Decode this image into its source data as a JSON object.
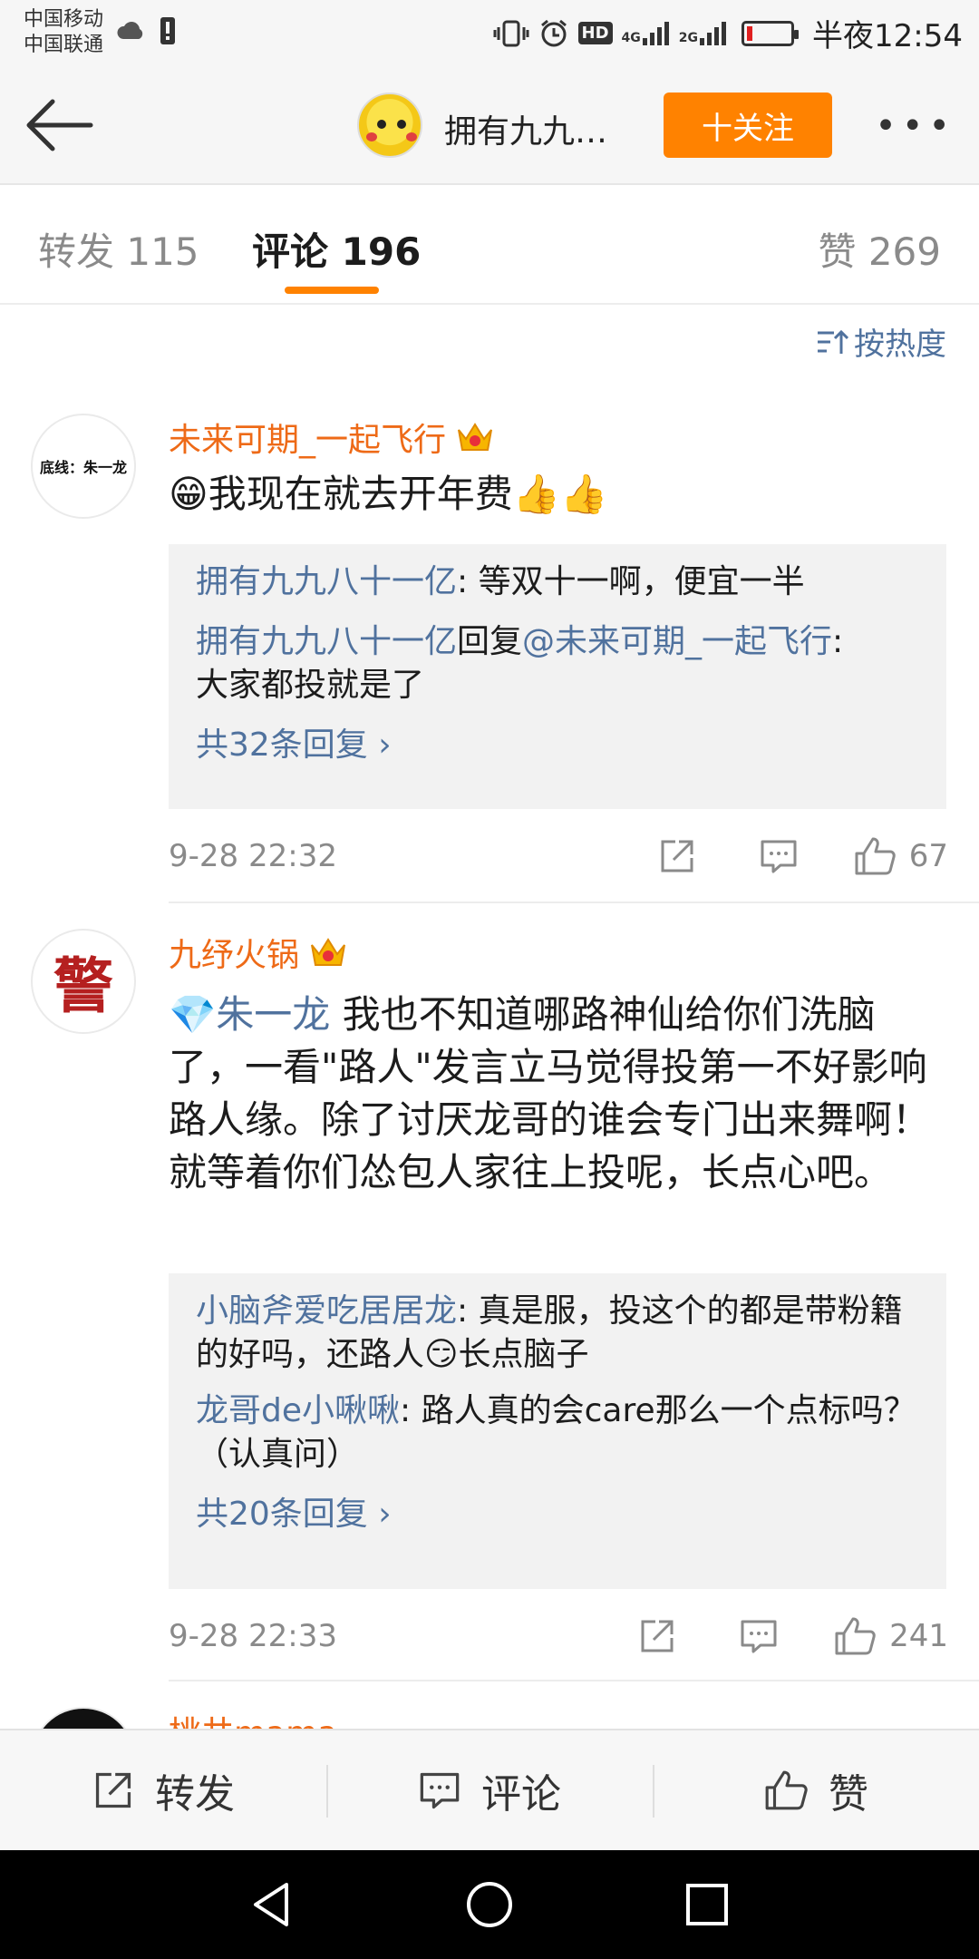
{
  "status_bar": {
    "carrier_1": "中国移动",
    "carrier_2": "中国联通",
    "network_1": "4G",
    "network_2": "2G",
    "hd_label": "HD",
    "time": "半夜12:54"
  },
  "navbar": {
    "title": "拥有九九…",
    "follow_label": "十关注",
    "more_label": "•••"
  },
  "tabs": {
    "repost": "转发 115",
    "comment": "评论 196",
    "like": "赞 269"
  },
  "sort_label": "按热度",
  "comments": [
    {
      "avatar_text": "底线：朱一龙",
      "username": "未来可期_一起飞行",
      "text": "😁我现在就去开年费👍👍",
      "replies": [
        {
          "user": "拥有九九八十一亿",
          "sep": ": ",
          "text": "等双十一啊，便宜一半"
        },
        {
          "user": "拥有九九八十一亿",
          "middle": "回复",
          "mention": "@未来可期_一起飞行",
          "sep": ":",
          "text": "大家都投就是了"
        }
      ],
      "more_replies": "共32条回复 ›",
      "time": "9-28 22:32",
      "likes": "67"
    },
    {
      "avatar_text": "警",
      "username": "九纾火锅",
      "mention": "💎朱一龙",
      "text": " 我也不知道哪路神仙给你们洗脑了，一看\"路人\"发言立马觉得投第一不好影响路人缘。除了讨厌龙哥的谁会专门出来舞啊！就等着你们怂包人家往上投呢，长点心吧。",
      "replies": [
        {
          "user": "小脑斧爱吃居居龙",
          "sep": ": ",
          "text": "真是服，投这个的都是带粉籍的好吗，还路人😏长点脑子"
        },
        {
          "user": "龙哥de小啾啾",
          "sep": ": ",
          "text": "路人真的会care那么一个点标吗？（认真问）"
        }
      ],
      "more_replies": "共20条回复 ›",
      "time": "9-28 22:33",
      "likes": "241"
    },
    {
      "username": "桃井mama"
    }
  ],
  "bottom_toolbar": {
    "repost": "转发",
    "comment": "评论",
    "like": "赞"
  },
  "colors": {
    "accent_orange": "#ff8200",
    "username_orange": "#ee6a17",
    "link_blue": "#50729e",
    "muted_gray": "#8a8a8a"
  }
}
